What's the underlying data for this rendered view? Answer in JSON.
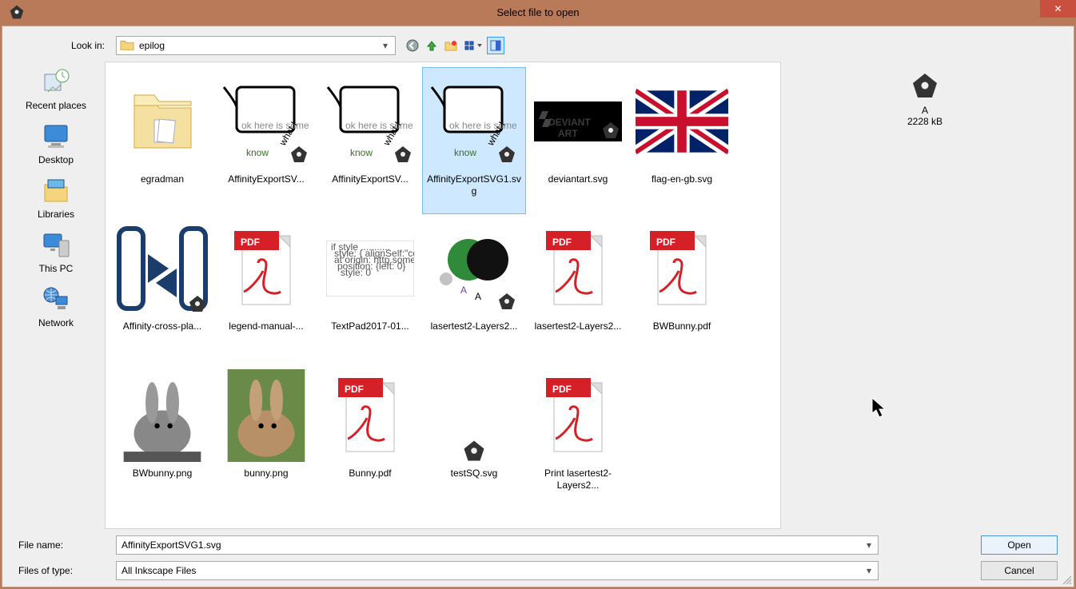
{
  "window": {
    "title": "Select file to open",
    "close_label": "✕"
  },
  "lookin": {
    "label": "Look in:",
    "value": "epilog"
  },
  "places": [
    {
      "id": "recent",
      "label": "Recent places"
    },
    {
      "id": "desktop",
      "label": "Desktop"
    },
    {
      "id": "libraries",
      "label": "Libraries"
    },
    {
      "id": "thispc",
      "label": "This PC"
    },
    {
      "id": "network",
      "label": "Network"
    }
  ],
  "files": [
    {
      "name": "egradman",
      "type": "folder",
      "selected": false
    },
    {
      "name": "AffinityExportSV...",
      "type": "svg-know",
      "selected": false
    },
    {
      "name": "AffinityExportSV...",
      "type": "svg-know",
      "selected": false
    },
    {
      "name": "AffinityExportSVG1.svg",
      "type": "svg-know",
      "selected": true
    },
    {
      "name": "deviantart.svg",
      "type": "deviantart",
      "selected": false
    },
    {
      "name": "flag-en-gb.svg",
      "type": "flag-gb",
      "selected": false
    },
    {
      "name": "Affinity-cross-pla...",
      "type": "cross-platform",
      "selected": false
    },
    {
      "name": "legend-manual-...",
      "type": "pdf",
      "selected": false
    },
    {
      "name": "TextPad2017-01...",
      "type": "text-thumb",
      "selected": false
    },
    {
      "name": "lasertest2-Layers2...",
      "type": "laser-thumb",
      "selected": false
    },
    {
      "name": "lasertest2-Layers2...",
      "type": "pdf",
      "selected": false
    },
    {
      "name": "BWBunny.pdf",
      "type": "pdf",
      "selected": false
    },
    {
      "name": "BWbunny.png",
      "type": "bunny-bw",
      "selected": false
    },
    {
      "name": "bunny.png",
      "type": "bunny-color",
      "selected": false
    },
    {
      "name": "Bunny.pdf",
      "type": "pdf",
      "selected": false
    },
    {
      "name": "testSQ.svg",
      "type": "inkscape-small",
      "selected": false
    },
    {
      "name": "Print lasertest2-Layers2...",
      "type": "pdf",
      "selected": false
    }
  ],
  "preview": {
    "name": "A",
    "size": "2228 kB"
  },
  "filename": {
    "label": "File name:",
    "value": "AffinityExportSVG1.svg"
  },
  "filetype": {
    "label": "Files of type:",
    "value": "All Inkscape Files"
  },
  "buttons": {
    "open": "Open",
    "cancel": "Cancel"
  }
}
